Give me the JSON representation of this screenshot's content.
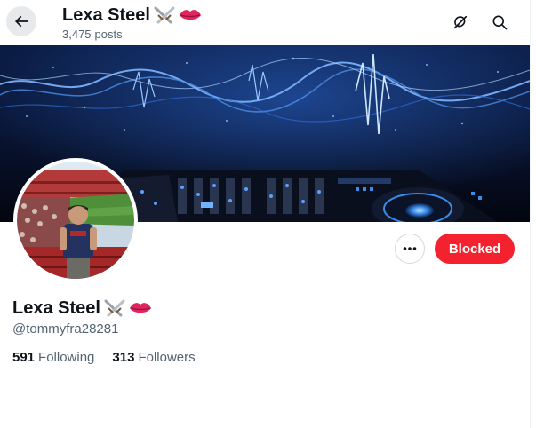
{
  "header": {
    "name": "Lexa Steel",
    "post_count": "3,475",
    "posts_label": "posts",
    "back_icon": "arrow-left-icon",
    "grok_icon": "grok-icon",
    "search_icon": "search-icon"
  },
  "profile": {
    "display_name": "Lexa Steel",
    "name_emojis": [
      "crossed-swords-icon",
      "lips-icon"
    ],
    "handle": "@tommyfra28281",
    "following_count": "591",
    "following_label": "Following",
    "followers_count": "313",
    "followers_label": "Followers"
  },
  "actions": {
    "more_icon": "more-dots-icon",
    "blocked_label": "Blocked"
  },
  "colors": {
    "blocked_red": "#f4212e",
    "secondary_text": "#536471",
    "primary_text": "#0f1419"
  }
}
